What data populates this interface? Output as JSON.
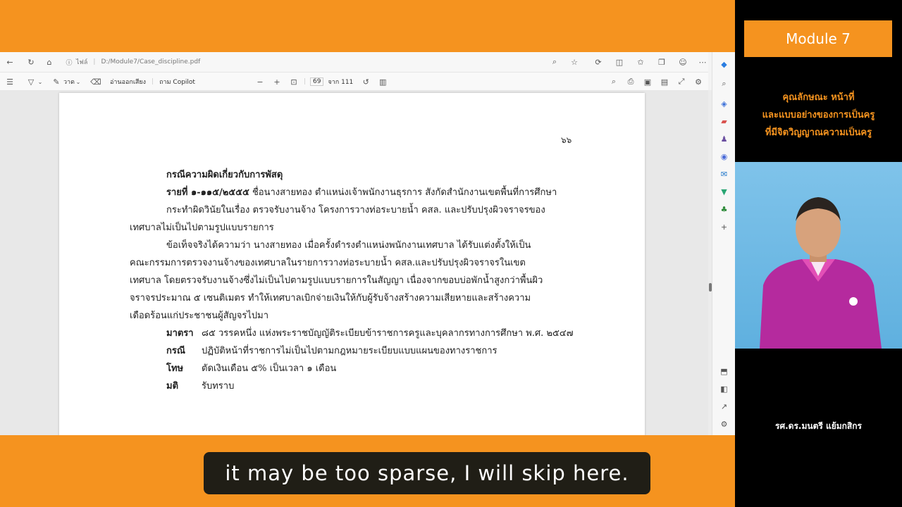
{
  "browser": {
    "url": "D:/Module7/Case_discipline.pdf",
    "url_label": "ไฟล์",
    "toolbar": {
      "draw_label": "วาด",
      "read_aloud_label": "อ่านออกเสียง",
      "ask_copilot_label": "ถาม Copilot",
      "page_current": "69",
      "page_total": "จาก 111"
    }
  },
  "document": {
    "page_number": "๖๖",
    "case_title": "กรณีความผิดเกี่ยวกับการพัสดุ",
    "case_id_label": "รายที่ ๑-๑๑๕/๒๕๕๕",
    "lines": [
      "ชื่อนางสายทอง ตำแหน่งเจ้าพนักงานธุรการ สังกัดสำนักงานเขตพื้นที่การศึกษา",
      "กระทำผิดวินัยในเรื่อง ตรวจรับงานจ้าง โครงการวางท่อระบายน้ำ คสล. และปรับปรุงผิวจราจรของ",
      "เทศบาลไม่เป็นไปตามรูปแบบรายการ",
      "ข้อเท็จจริงได้ความว่า นางสายทอง เมื่อครั้งดำรงตำแหน่งพนักงานเทศบาล ได้รับแต่งตั้งให้เป็น",
      "คณะกรรมการตรวจงานจ้างของเทศบาลในรายการวางท่อระบายน้ำ คสล.และปรับปรุงผิวจราจรในเขต",
      "เทศบาล โดยตรวจรับงานจ้างซึ่งไม่เป็นไปตามรูปแบบรายการในสัญญา เนื่องจากขอบบ่อพักน้ำสูงกว่าพื้นผิว",
      "จราจรประมาณ ๕ เซนติเมตร ทำให้เทศบาลเบิกจ่ายเงินให้กับผู้รับจ้างสร้างความเสียหายและสร้างความ",
      "เดือดร้อนแก่ประชาชนผู้สัญจรไปมา"
    ],
    "meta": [
      {
        "label": "มาตรา",
        "value": "๘๕ วรรคหนึ่ง แห่งพระราชบัญญัติระเบียบข้าราชการครูและบุคลากรทางการศึกษา พ.ศ. ๒๕๔๗"
      },
      {
        "label": "กรณี",
        "value": "ปฏิบัติหน้าที่ราชการไม่เป็นไปตามกฎหมายระเบียบแบบแผนของทางราชการ"
      },
      {
        "label": "โทษ",
        "value": "ตัดเงินเดือน ๕% เป็นเวลา ๑ เดือน"
      },
      {
        "label": "มติ",
        "value": "รับทราบ"
      }
    ]
  },
  "panel": {
    "module_label": "Module 7",
    "title_lines": [
      "คุณลักษณะ หน้าที่",
      "และแบบอย่างของการเป็นครู",
      "ที่มีจิตวิญญาณความเป็นครู"
    ],
    "presenter": "รศ.ดร.มนตรี แย้มกสิกร"
  },
  "caption": "it may be too sparse, I will skip here.",
  "colors": {
    "accent": "#f5931f",
    "panel_bg": "#000000",
    "caption_bg": "#201e16"
  }
}
